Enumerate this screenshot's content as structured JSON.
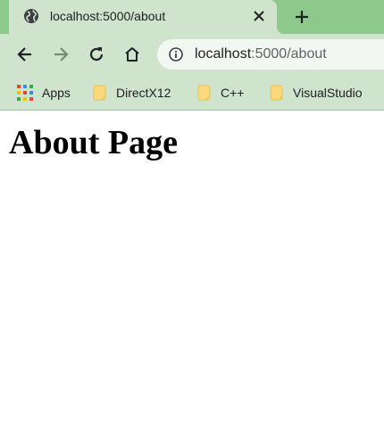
{
  "tab": {
    "title": "localhost:5000/about",
    "favicon": "globe-icon"
  },
  "toolbar": {
    "back_icon": "back-arrow-icon",
    "forward_icon": "forward-arrow-icon",
    "reload_icon": "reload-icon",
    "home_icon": "home-icon",
    "url_host": "localhost",
    "url_path": ":5000/about",
    "info_icon": "info-icon"
  },
  "bookmarks": [
    {
      "label": "Apps",
      "icon": "apps-grid-icon"
    },
    {
      "label": "DirectX12",
      "icon": "folder-icon"
    },
    {
      "label": "C++",
      "icon": "folder-icon"
    },
    {
      "label": "VisualStudio",
      "icon": "folder-icon"
    }
  ],
  "page": {
    "heading": "About Page"
  },
  "colors": {
    "tabstrip": "#8cc98a",
    "toolbar": "#cfe3cd",
    "omnibox": "#f2f7f1",
    "folder": "#f9d97c"
  }
}
